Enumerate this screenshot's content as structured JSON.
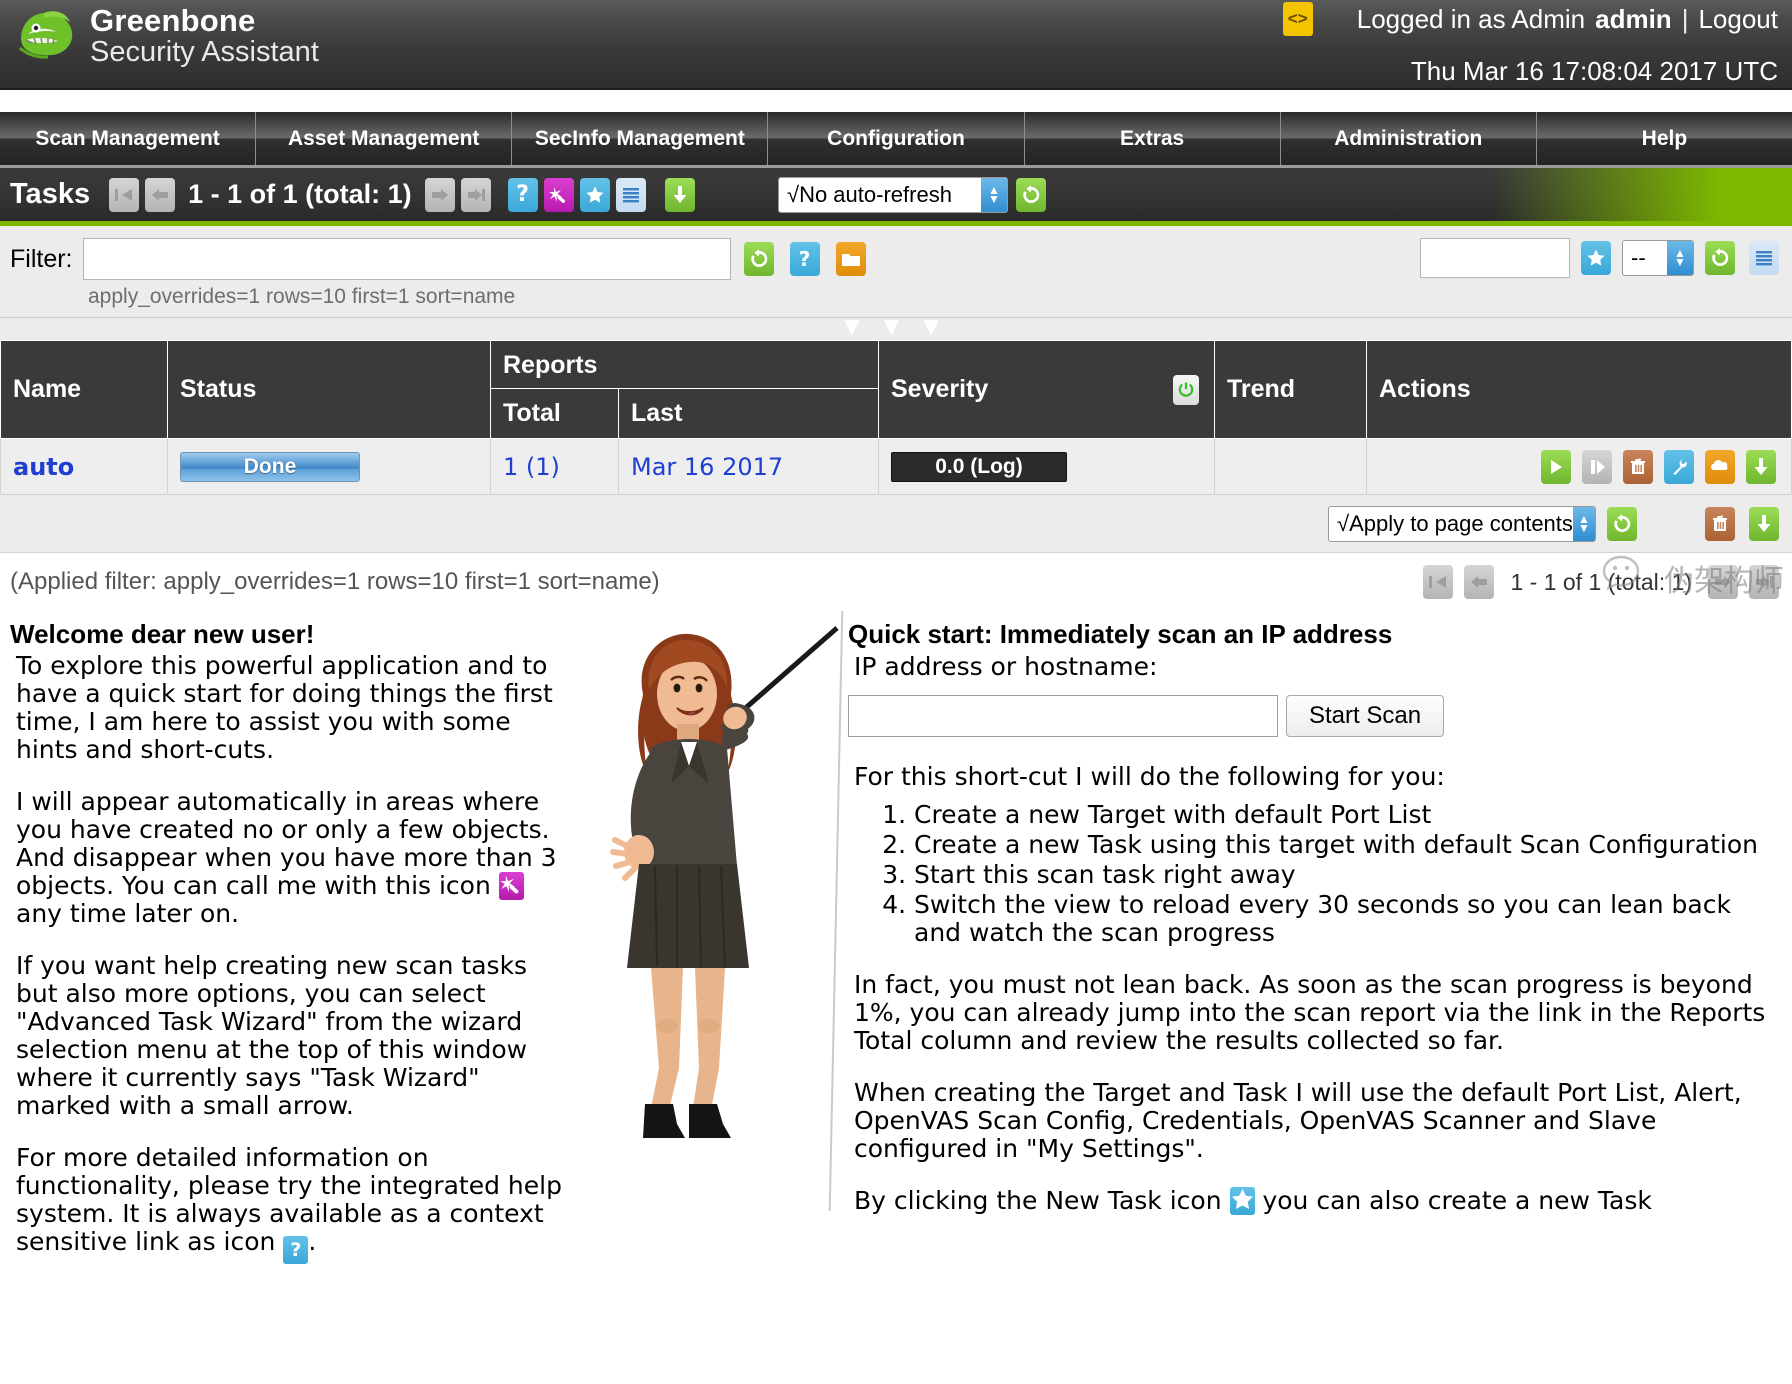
{
  "header": {
    "brand_line1": "Greenbone",
    "brand_line2": "Security Assistant",
    "logo_icon": "dragon-logo-icon",
    "code_icon": "code-brackets-icon",
    "login_prefix": "Logged in as Admin",
    "login_user": "admin",
    "login_separator": "|",
    "logout_label": "Logout",
    "datetime": "Thu Mar 16 17:08:04 2017 UTC"
  },
  "menu": {
    "items": [
      {
        "label": "Scan Management",
        "name": "menu-scan-management"
      },
      {
        "label": "Asset Management",
        "name": "menu-asset-management"
      },
      {
        "label": "SecInfo Management",
        "name": "menu-secinfo-management"
      },
      {
        "label": "Configuration",
        "name": "menu-configuration"
      },
      {
        "label": "Extras",
        "name": "menu-extras"
      },
      {
        "label": "Administration",
        "name": "menu-administration"
      },
      {
        "label": "Help",
        "name": "menu-help"
      }
    ]
  },
  "toolbar": {
    "title": "Tasks",
    "count_text": "1 - 1 of 1 (total: 1)",
    "icons": [
      "first-page-icon",
      "previous-page-icon",
      "next-page-icon",
      "last-page-icon",
      "help-icon",
      "wizard-icon",
      "new-task-icon",
      "task-list-icon",
      "download-icon"
    ],
    "autorefresh_value": "√No auto-refresh",
    "refresh_icon": "refresh-icon"
  },
  "filter": {
    "label": "Filter:",
    "value": "",
    "placeholder": "",
    "applied_terms": "apply_overrides=1 rows=10 first=1 sort=name",
    "update_icon": "refresh-icon",
    "help_icon": "help-icon",
    "new-filter_icon": "new-filter-icon",
    "name_value": "",
    "star_icon": "star-icon",
    "dropdown_value": "--",
    "reset_icon": "refresh-icon",
    "list_icon": "filter-list-icon"
  },
  "sort_arrows": "▼ ▼ ▼",
  "table": {
    "columns": [
      "Name",
      "Status",
      "Reports",
      "Severity",
      "Trend",
      "Actions"
    ],
    "reports_sub": [
      "Total",
      "Last"
    ],
    "severity_icon": "power-toggle-icon",
    "rows": [
      {
        "name": "auto",
        "status": "Done",
        "reports_total": "1 (1)",
        "reports_last": "Mar 16 2017",
        "severity": "0.0 (Log)",
        "trend": "",
        "actions": [
          "start-scan-icon",
          "pause-scan-icon",
          "delete-icon",
          "edit-icon",
          "clone-icon",
          "export-icon"
        ]
      }
    ]
  },
  "bulk": {
    "apply_value": "√Apply to page contents",
    "refresh_icon": "refresh-icon",
    "delete_icon": "trash-icon",
    "export_icon": "download-icon"
  },
  "applied": {
    "text": "(Applied filter: apply_overrides=1 rows=10 first=1 sort=name)",
    "pager_text": "1 - 1 of 1 (total: 1)",
    "pager_icons": [
      "first-page-icon",
      "previous-page-icon",
      "next-page-icon",
      "last-page-icon"
    ]
  },
  "welcome": {
    "heading": "Welcome dear new user!",
    "p1": "To explore this powerful application and to have a quick start for doing things the first time, I am here to assist you with some hints and short-cuts.",
    "p2a": "I will appear automatically in areas where you have created no or only a few objects. And disappear when you have more than 3 objects. You can call me with this icon ",
    "p2b": " any time later on.",
    "p3": "If you want help creating new scan tasks but also more options, you can select \"Advanced Task Wizard\" from the wizard selection menu at the top of this window where it currently says \"Task Wizard\" marked with a small arrow.",
    "p4a": "For more detailed information on functionality, please try the integrated help system. It is always available as a context sensitive link as icon ",
    "p4b": ".",
    "wizard_icon": "wizard-icon",
    "help_icon": "help-icon",
    "illustration": "teacher-pointer-illustration"
  },
  "quickstart": {
    "heading": "Quick start: Immediately scan an IP address",
    "ip_label": "IP address or hostname:",
    "ip_value": "",
    "ip_placeholder": "",
    "start_button": "Start Scan",
    "intro": "For this short-cut I will do the following for you:",
    "steps": [
      "Create a new Target with default Port List",
      "Create a new Task using this target with default Scan Configuration",
      "Start this scan task right away",
      "Switch the view to reload every 30 seconds so you can lean back and watch the scan progress"
    ],
    "p1": "In fact, you must not lean back. As soon as the scan progress is beyond 1%, you can already jump into the scan report via the link in the Reports Total column and review the results collected so far.",
    "p2": "When creating the Target and Task I will use the default Port List, Alert, OpenVAS Scan Config, Credentials, OpenVAS Scanner and Slave configured in \"My Settings\".",
    "p3a": "By clicking the New Task icon ",
    "p3b": " you can also create a new Task",
    "newtask_icon": "new-task-icon"
  },
  "watermark": {
    "text": "伪架构师",
    "icon": "wechat-icon"
  },
  "colors": {
    "accent_green": "#7db700",
    "link_blue": "#1f3fd0",
    "header_dark": "#3a3a3a",
    "wizard_magenta": "#c92bc0",
    "icon_blue": "#3aa8d8",
    "badge_yellow": "#f5c400"
  }
}
